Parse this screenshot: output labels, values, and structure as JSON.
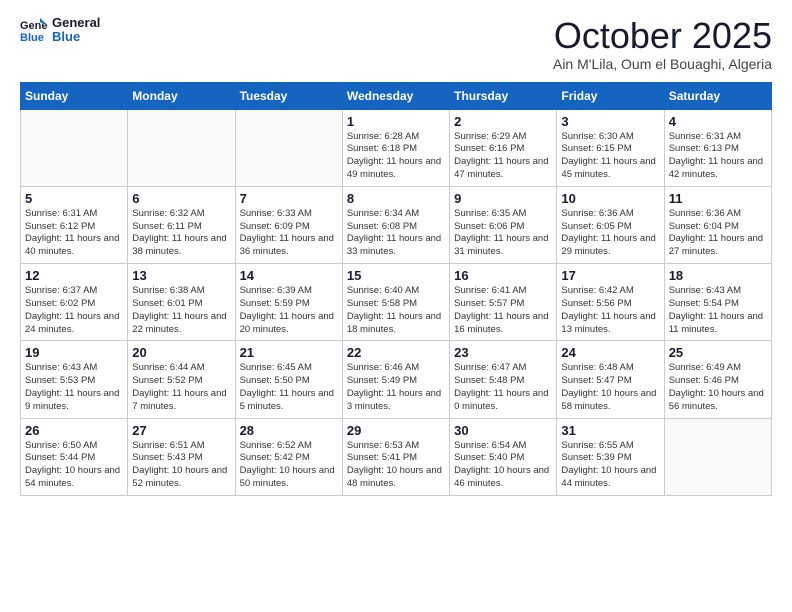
{
  "header": {
    "logo_line1": "General",
    "logo_line2": "Blue",
    "month": "October 2025",
    "location": "Ain M'Lila, Oum el Bouaghi, Algeria"
  },
  "weekdays": [
    "Sunday",
    "Monday",
    "Tuesday",
    "Wednesday",
    "Thursday",
    "Friday",
    "Saturday"
  ],
  "weeks": [
    [
      {
        "day": "",
        "info": ""
      },
      {
        "day": "",
        "info": ""
      },
      {
        "day": "",
        "info": ""
      },
      {
        "day": "1",
        "info": "Sunrise: 6:28 AM\nSunset: 6:18 PM\nDaylight: 11 hours and 49 minutes."
      },
      {
        "day": "2",
        "info": "Sunrise: 6:29 AM\nSunset: 6:16 PM\nDaylight: 11 hours and 47 minutes."
      },
      {
        "day": "3",
        "info": "Sunrise: 6:30 AM\nSunset: 6:15 PM\nDaylight: 11 hours and 45 minutes."
      },
      {
        "day": "4",
        "info": "Sunrise: 6:31 AM\nSunset: 6:13 PM\nDaylight: 11 hours and 42 minutes."
      }
    ],
    [
      {
        "day": "5",
        "info": "Sunrise: 6:31 AM\nSunset: 6:12 PM\nDaylight: 11 hours and 40 minutes."
      },
      {
        "day": "6",
        "info": "Sunrise: 6:32 AM\nSunset: 6:11 PM\nDaylight: 11 hours and 38 minutes."
      },
      {
        "day": "7",
        "info": "Sunrise: 6:33 AM\nSunset: 6:09 PM\nDaylight: 11 hours and 36 minutes."
      },
      {
        "day": "8",
        "info": "Sunrise: 6:34 AM\nSunset: 6:08 PM\nDaylight: 11 hours and 33 minutes."
      },
      {
        "day": "9",
        "info": "Sunrise: 6:35 AM\nSunset: 6:06 PM\nDaylight: 11 hours and 31 minutes."
      },
      {
        "day": "10",
        "info": "Sunrise: 6:36 AM\nSunset: 6:05 PM\nDaylight: 11 hours and 29 minutes."
      },
      {
        "day": "11",
        "info": "Sunrise: 6:36 AM\nSunset: 6:04 PM\nDaylight: 11 hours and 27 minutes."
      }
    ],
    [
      {
        "day": "12",
        "info": "Sunrise: 6:37 AM\nSunset: 6:02 PM\nDaylight: 11 hours and 24 minutes."
      },
      {
        "day": "13",
        "info": "Sunrise: 6:38 AM\nSunset: 6:01 PM\nDaylight: 11 hours and 22 minutes."
      },
      {
        "day": "14",
        "info": "Sunrise: 6:39 AM\nSunset: 5:59 PM\nDaylight: 11 hours and 20 minutes."
      },
      {
        "day": "15",
        "info": "Sunrise: 6:40 AM\nSunset: 5:58 PM\nDaylight: 11 hours and 18 minutes."
      },
      {
        "day": "16",
        "info": "Sunrise: 6:41 AM\nSunset: 5:57 PM\nDaylight: 11 hours and 16 minutes."
      },
      {
        "day": "17",
        "info": "Sunrise: 6:42 AM\nSunset: 5:56 PM\nDaylight: 11 hours and 13 minutes."
      },
      {
        "day": "18",
        "info": "Sunrise: 6:43 AM\nSunset: 5:54 PM\nDaylight: 11 hours and 11 minutes."
      }
    ],
    [
      {
        "day": "19",
        "info": "Sunrise: 6:43 AM\nSunset: 5:53 PM\nDaylight: 11 hours and 9 minutes."
      },
      {
        "day": "20",
        "info": "Sunrise: 6:44 AM\nSunset: 5:52 PM\nDaylight: 11 hours and 7 minutes."
      },
      {
        "day": "21",
        "info": "Sunrise: 6:45 AM\nSunset: 5:50 PM\nDaylight: 11 hours and 5 minutes."
      },
      {
        "day": "22",
        "info": "Sunrise: 6:46 AM\nSunset: 5:49 PM\nDaylight: 11 hours and 3 minutes."
      },
      {
        "day": "23",
        "info": "Sunrise: 6:47 AM\nSunset: 5:48 PM\nDaylight: 11 hours and 0 minutes."
      },
      {
        "day": "24",
        "info": "Sunrise: 6:48 AM\nSunset: 5:47 PM\nDaylight: 10 hours and 58 minutes."
      },
      {
        "day": "25",
        "info": "Sunrise: 6:49 AM\nSunset: 5:46 PM\nDaylight: 10 hours and 56 minutes."
      }
    ],
    [
      {
        "day": "26",
        "info": "Sunrise: 6:50 AM\nSunset: 5:44 PM\nDaylight: 10 hours and 54 minutes."
      },
      {
        "day": "27",
        "info": "Sunrise: 6:51 AM\nSunset: 5:43 PM\nDaylight: 10 hours and 52 minutes."
      },
      {
        "day": "28",
        "info": "Sunrise: 6:52 AM\nSunset: 5:42 PM\nDaylight: 10 hours and 50 minutes."
      },
      {
        "day": "29",
        "info": "Sunrise: 6:53 AM\nSunset: 5:41 PM\nDaylight: 10 hours and 48 minutes."
      },
      {
        "day": "30",
        "info": "Sunrise: 6:54 AM\nSunset: 5:40 PM\nDaylight: 10 hours and 46 minutes."
      },
      {
        "day": "31",
        "info": "Sunrise: 6:55 AM\nSunset: 5:39 PM\nDaylight: 10 hours and 44 minutes."
      },
      {
        "day": "",
        "info": ""
      }
    ]
  ]
}
